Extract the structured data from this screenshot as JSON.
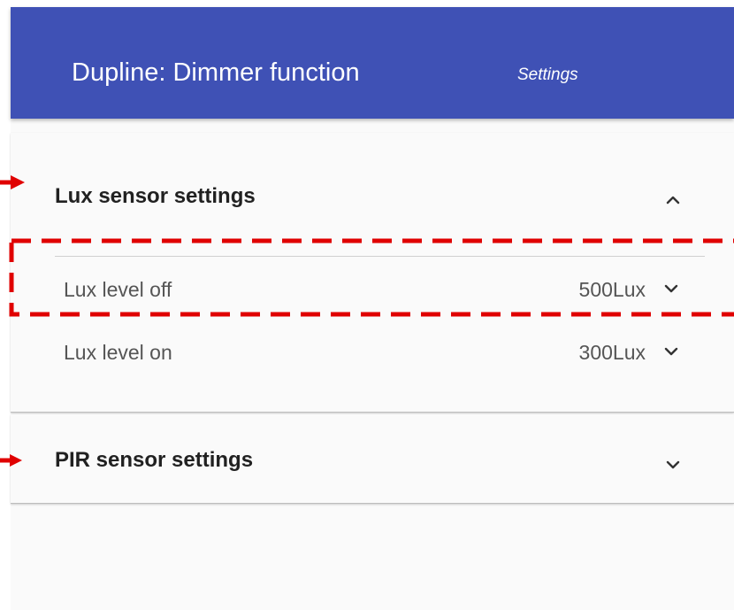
{
  "header": {
    "title": "Dupline: Dimmer function",
    "subtitle": "Settings",
    "background_color": "#3f51b5"
  },
  "panels": [
    {
      "title": "Lux sensor settings",
      "expanded": true,
      "toggle_icon": "chevron-up-icon",
      "rows": [
        {
          "label": "Lux level off",
          "value": "500Lux",
          "icon": "chevron-down-icon",
          "highlighted": true
        },
        {
          "label": "Lux level on",
          "value": "300Lux",
          "icon": "chevron-down-icon",
          "highlighted": false
        }
      ]
    },
    {
      "title": "PIR sensor settings",
      "expanded": false,
      "toggle_icon": "chevron-down-icon",
      "rows": []
    }
  ],
  "annotations": {
    "highlight_color": "#e00000",
    "arrow_icon": "arrow-right-icon",
    "highlight_style": "dashed-rectangle"
  }
}
